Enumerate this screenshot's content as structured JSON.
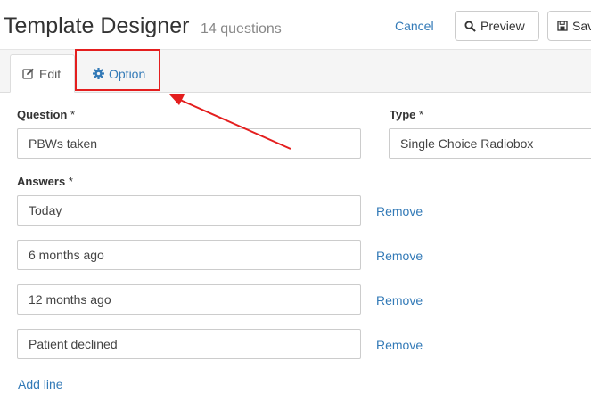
{
  "header": {
    "title": "Template Designer",
    "question_count": "14 questions",
    "cancel_label": "Cancel",
    "preview_label": "Preview",
    "save_label": "Save"
  },
  "tabs": [
    {
      "label": "Edit",
      "icon": "edit-icon",
      "active": true
    },
    {
      "label": "Option",
      "icon": "gear-icon",
      "active": false
    }
  ],
  "form": {
    "question_label": "Question",
    "question_value": "PBWs taken",
    "type_label": "Type",
    "type_value": "Single Choice Radiobox",
    "required_marker": "*",
    "answers_label": "Answers",
    "answers": [
      {
        "value": "Today",
        "remove_label": "Remove"
      },
      {
        "value": "6 months ago",
        "remove_label": "Remove"
      },
      {
        "value": "12 months ago",
        "remove_label": "Remove"
      },
      {
        "value": "Patient declined",
        "remove_label": "Remove"
      }
    ],
    "add_line_label": "Add line"
  },
  "colors": {
    "link": "#337ab7",
    "annotation": "#e41e1e",
    "border": "#cccccc"
  }
}
